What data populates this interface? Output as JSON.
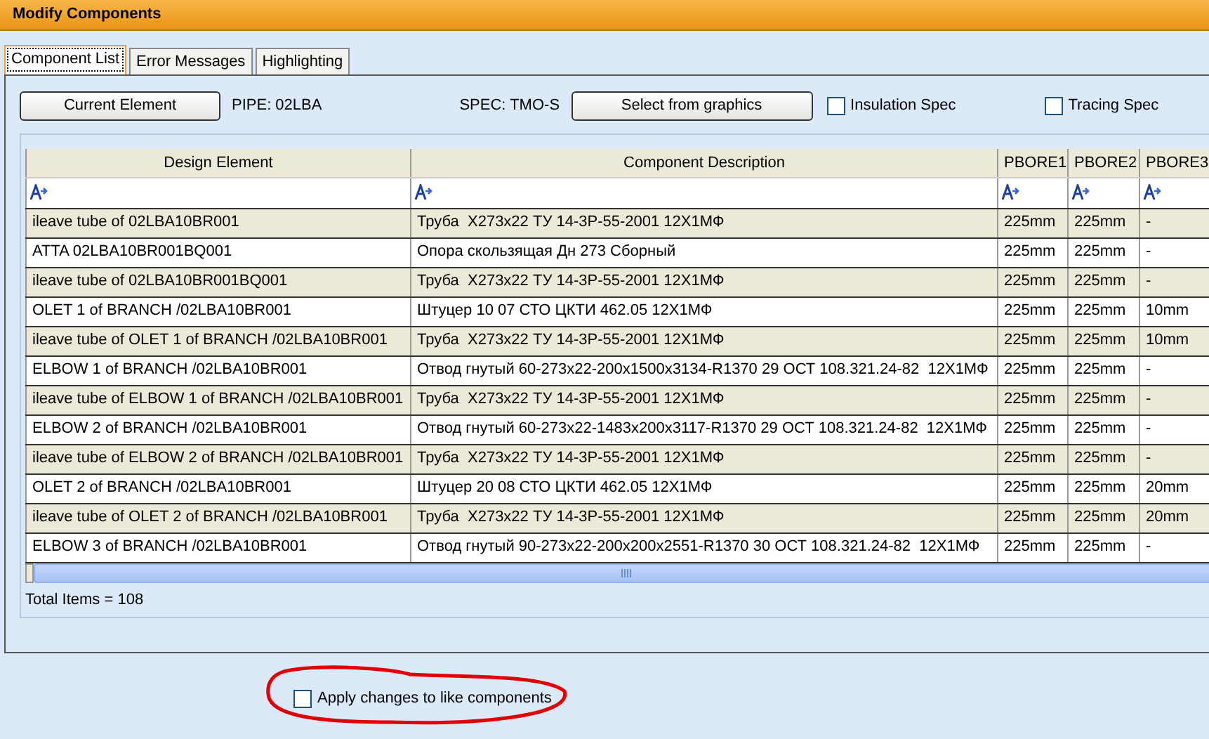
{
  "window": {
    "title": "Modify Components"
  },
  "tabs": [
    {
      "label": "Component List",
      "selected": true
    },
    {
      "label": "Error Messages",
      "selected": false
    },
    {
      "label": "Highlighting",
      "selected": false
    }
  ],
  "toolbar": {
    "current_button": "Current Element",
    "pipe": "PIPE: 02LBA",
    "spec": "SPEC: TMO-S",
    "select_button": "Select from graphics",
    "checkboxes": [
      {
        "label": "Insulation Spec",
        "checked": false
      },
      {
        "label": "Tracing Spec",
        "checked": false
      }
    ]
  },
  "table": {
    "columns": [
      "Design Element",
      "Component Description",
      "PBORE1",
      "PBORE2",
      "PBORE3"
    ],
    "rows": [
      [
        "ileave tube of 02LBA10BR001",
        "Труба  Х273х22 ТУ 14-3Р-55-2001 12Х1МФ",
        "225mm",
        "225mm",
        "-"
      ],
      [
        "ATTA 02LBA10BR001BQ001",
        "Опора скользящая Дн 273 Сборный",
        "225mm",
        "225mm",
        "-"
      ],
      [
        "ileave tube of 02LBA10BR001BQ001",
        "Труба  Х273х22 ТУ 14-3Р-55-2001 12Х1МФ",
        "225mm",
        "225mm",
        "-"
      ],
      [
        "OLET 1 of BRANCH /02LBA10BR001",
        "Штуцер 10 07 СТО ЦКТИ 462.05 12Х1МФ",
        "225mm",
        "225mm",
        "10mm"
      ],
      [
        "ileave tube of OLET 1 of BRANCH /02LBA10BR001",
        "Труба  Х273х22 ТУ 14-3Р-55-2001 12Х1МФ",
        "225mm",
        "225mm",
        "10mm"
      ],
      [
        "ELBOW 1 of BRANCH /02LBA10BR001",
        "Отвод гнутый 60-273х22-200х1500х3134-R1370 29 ОСТ 108.321.24-82  12Х1МФ",
        "225mm",
        "225mm",
        "-"
      ],
      [
        "ileave tube of ELBOW 1 of BRANCH /02LBA10BR001",
        "Труба  Х273х22 ТУ 14-3Р-55-2001 12Х1МФ",
        "225mm",
        "225mm",
        "-"
      ],
      [
        "ELBOW 2 of BRANCH /02LBA10BR001",
        "Отвод гнутый 60-273х22-1483х200х3117-R1370 29 ОСТ 108.321.24-82  12Х1МФ",
        "225mm",
        "225mm",
        "-"
      ],
      [
        "ileave tube of ELBOW 2 of BRANCH /02LBA10BR001",
        "Труба  Х273х22 ТУ 14-3Р-55-2001 12Х1МФ",
        "225mm",
        "225mm",
        "-"
      ],
      [
        "OLET 2 of BRANCH /02LBA10BR001",
        "Штуцер 20 08 СТО ЦКТИ 462.05 12Х1МФ",
        "225mm",
        "225mm",
        "20mm"
      ],
      [
        "ileave tube of OLET 2 of BRANCH /02LBA10BR001",
        "Труба  Х273х22 ТУ 14-3Р-55-2001 12Х1МФ",
        "225mm",
        "225mm",
        "20mm"
      ],
      [
        "ELBOW 3 of BRANCH /02LBA10BR001",
        "Отвод гнутый 90-273х22-200х200х2551-R1370 30 ОСТ 108.321.24-82  12Х1МФ",
        "225mm",
        "225mm",
        "-"
      ]
    ]
  },
  "total": "Total Items = 108",
  "apply": {
    "label": "Apply changes to like components",
    "checked": false
  }
}
